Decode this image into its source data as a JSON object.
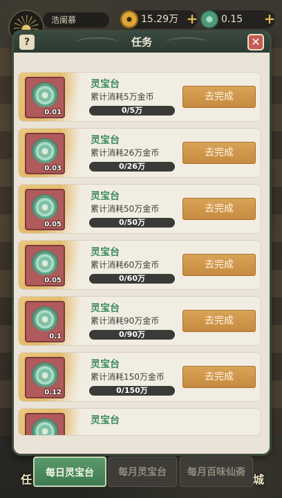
{
  "topbar": {
    "player_name": "浩阑慕",
    "gold": "15.29万",
    "jade": "0.15",
    "plus": "+"
  },
  "modal": {
    "title": "任务",
    "help": "?",
    "close": "✕"
  },
  "tasks": [
    {
      "name": "灵宝台",
      "desc": "累计消耗5万金币",
      "progress": "0/5万",
      "reward_qty": "0.01",
      "button": "去完成"
    },
    {
      "name": "灵宝台",
      "desc": "累计消耗26万金币",
      "progress": "0/26万",
      "reward_qty": "0.03",
      "button": "去完成"
    },
    {
      "name": "灵宝台",
      "desc": "累计消耗50万金币",
      "progress": "0/50万",
      "reward_qty": "0.05",
      "button": "去完成"
    },
    {
      "name": "灵宝台",
      "desc": "累计消耗60万金币",
      "progress": "0/60万",
      "reward_qty": "0.05",
      "button": "去完成"
    },
    {
      "name": "灵宝台",
      "desc": "累计消耗90万金币",
      "progress": "0/90万",
      "reward_qty": "0.1",
      "button": "去完成"
    },
    {
      "name": "灵宝台",
      "desc": "累计消耗150万金币",
      "progress": "0/150万",
      "reward_qty": "0.12",
      "button": "去完成"
    },
    {
      "name": "灵宝台"
    }
  ],
  "tabs": [
    {
      "label": "每日灵宝台",
      "active": true
    },
    {
      "label": "每月灵宝台",
      "active": false
    },
    {
      "label": "每月百味仙斋",
      "active": false
    }
  ],
  "side_left": "任",
  "side_right": "城",
  "colors": {
    "accent_green": "#3e8a5c",
    "button_orange": "#c68a3f",
    "close_red": "#c65b55"
  }
}
